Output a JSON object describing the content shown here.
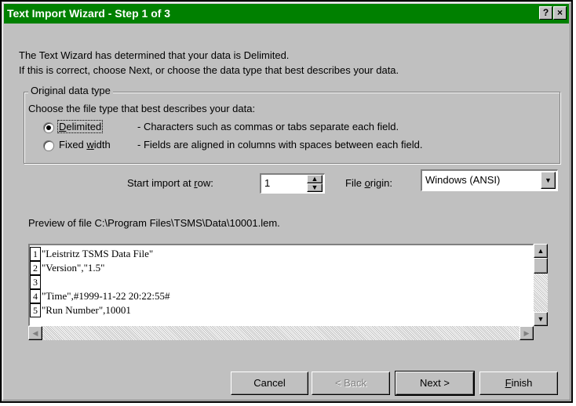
{
  "window": {
    "title": "Text Import Wizard - Step 1 of 3",
    "help_glyph": "?",
    "close_glyph": "×"
  },
  "intro": {
    "line1": "The Text Wizard has determined that your data is Delimited.",
    "line2": "If this is correct, choose Next, or choose the data type that best describes your data."
  },
  "data_type": {
    "group_label": "Original data type",
    "prompt": "Choose the file type that best describes your data:",
    "options": [
      {
        "label_pre": "",
        "label_key": "D",
        "label_post": "elimited",
        "description": "- Characters such as commas or tabs separate each field.",
        "selected": true
      },
      {
        "label_pre": "Fixed ",
        "label_key": "w",
        "label_post": "idth",
        "description": "- Fields are aligned in columns with spaces between each field.",
        "selected": false
      }
    ]
  },
  "start_row": {
    "label_pre": "Start import at ",
    "label_key": "r",
    "label_post": "ow:",
    "value": "1"
  },
  "file_origin": {
    "label_pre": "File ",
    "label_key": "o",
    "label_post": "rigin:",
    "value": "Windows (ANSI)"
  },
  "preview": {
    "caption": "Preview of file C:\\Program Files\\TSMS\\Data\\10001.lem.",
    "lines": [
      {
        "num": "1",
        "text": "\"Leistritz TSMS Data File\""
      },
      {
        "num": "2",
        "text": "\"Version\",\"1.5\""
      },
      {
        "num": "3",
        "text": ""
      },
      {
        "num": "4",
        "text": "\"Time\",#1999-11-22 20:22:55#"
      },
      {
        "num": "5",
        "text": "\"Run Number\",10001"
      }
    ]
  },
  "buttons": {
    "cancel": "Cancel",
    "back": "< Back",
    "next": "Next >",
    "finish_key": "F",
    "finish_rest": "inish"
  },
  "colors": {
    "titlebar": "#008000",
    "face": "#c0c0c0"
  }
}
